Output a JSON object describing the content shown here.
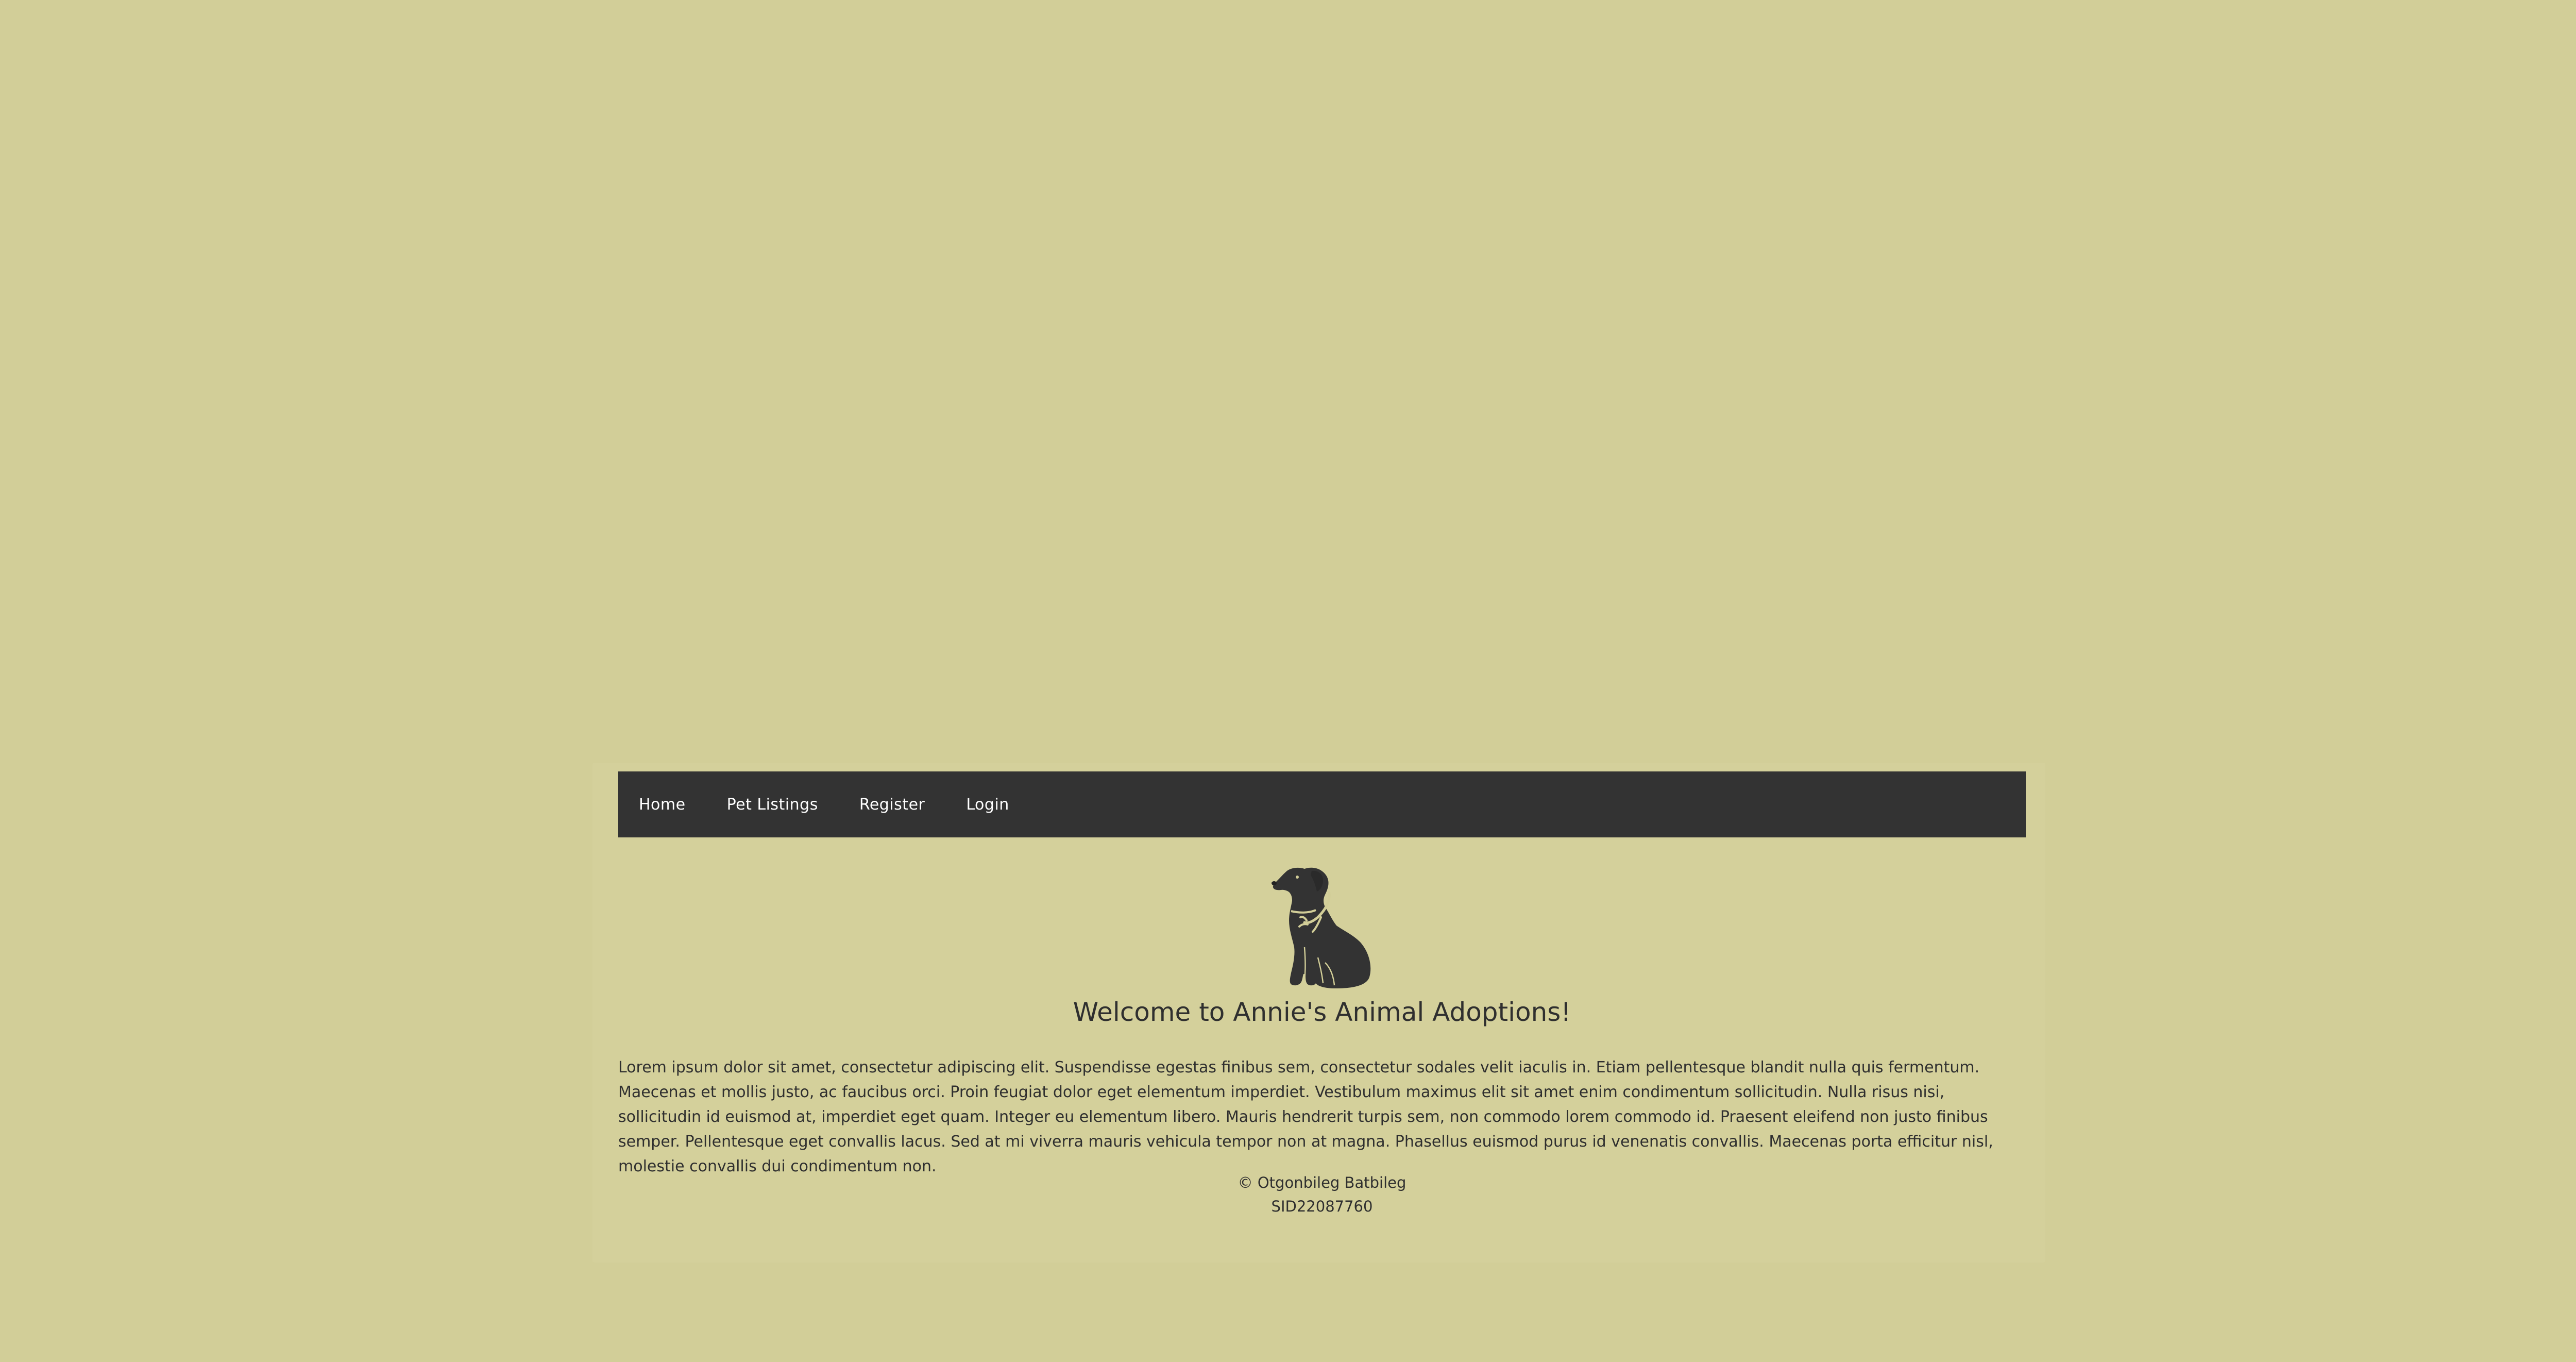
{
  "nav": {
    "items": [
      {
        "label": "Home"
      },
      {
        "label": "Pet Listings"
      },
      {
        "label": "Register"
      },
      {
        "label": "Login"
      }
    ]
  },
  "hero": {
    "logo_icon": "dog-logo-icon",
    "title": "Welcome to Annie's Animal Adoptions!"
  },
  "intro": {
    "text": "Lorem ipsum dolor sit amet, consectetur adipiscing elit. Suspendisse egestas finibus sem, consectetur sodales velit iaculis in. Etiam pellentesque blandit nulla quis fermentum. Maecenas et mollis justo, ac faucibus orci. Proin feugiat dolor eget elementum imperdiet. Vestibulum maximus elit sit amet enim condimentum sollicitudin. Nulla risus nisi, sollicitudin id euismod at, imperdiet eget quam. Integer eu elementum libero. Mauris hendrerit turpis sem, non commodo lorem commodo id. Praesent eleifend non justo finibus semper. Pellentesque eget convallis lacus. Sed at mi viverra mauris vehicula tempor non at magna. Phasellus euismod purus id venenatis convallis. Maecenas porta efficitur nisl, molestie convallis dui condimentum non."
  },
  "footer": {
    "copyright": "© Otgonbileg Batbileg",
    "student_id": "SID22087760"
  },
  "colors": {
    "background": "#d2ce98",
    "navbar": "#333333",
    "text": "#2f2f2f",
    "nav_text": "#ffffff"
  }
}
